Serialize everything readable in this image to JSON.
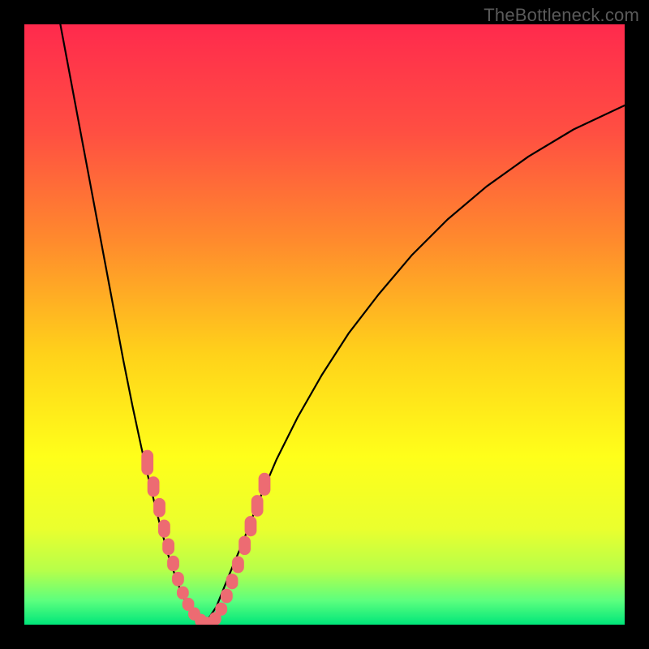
{
  "watermark": "TheBottleneck.com",
  "chart_data": {
    "type": "line",
    "title": "",
    "xlabel": "",
    "ylabel": "",
    "xlim": [
      0,
      100
    ],
    "ylim": [
      0,
      100
    ],
    "axes_visible": false,
    "grid": false,
    "background_gradient_stops": [
      {
        "offset": 0.0,
        "color": "#ff2a4d"
      },
      {
        "offset": 0.18,
        "color": "#ff4f42"
      },
      {
        "offset": 0.36,
        "color": "#ff8a2d"
      },
      {
        "offset": 0.55,
        "color": "#ffd21a"
      },
      {
        "offset": 0.72,
        "color": "#ffff1a"
      },
      {
        "offset": 0.84,
        "color": "#eaff2e"
      },
      {
        "offset": 0.91,
        "color": "#b6ff4a"
      },
      {
        "offset": 0.96,
        "color": "#5cff7e"
      },
      {
        "offset": 1.0,
        "color": "#00e67a"
      }
    ],
    "series": [
      {
        "name": "left-curve",
        "stroke": "#000000",
        "stroke_width": 2.2,
        "points": [
          {
            "x": 6.0,
            "y": 100.0
          },
          {
            "x": 7.5,
            "y": 92.0
          },
          {
            "x": 9.0,
            "y": 84.0
          },
          {
            "x": 10.5,
            "y": 76.0
          },
          {
            "x": 12.0,
            "y": 68.0
          },
          {
            "x": 13.5,
            "y": 60.0
          },
          {
            "x": 15.0,
            "y": 52.0
          },
          {
            "x": 16.5,
            "y": 44.0
          },
          {
            "x": 18.0,
            "y": 36.5
          },
          {
            "x": 19.5,
            "y": 29.5
          },
          {
            "x": 21.0,
            "y": 23.0
          },
          {
            "x": 22.5,
            "y": 17.0
          },
          {
            "x": 24.0,
            "y": 11.5
          },
          {
            "x": 25.5,
            "y": 7.0
          },
          {
            "x": 27.0,
            "y": 3.5
          },
          {
            "x": 28.5,
            "y": 1.2
          },
          {
            "x": 30.0,
            "y": 0.0
          }
        ]
      },
      {
        "name": "right-curve",
        "stroke": "#000000",
        "stroke_width": 2.2,
        "points": [
          {
            "x": 30.0,
            "y": 0.0
          },
          {
            "x": 32.0,
            "y": 3.0
          },
          {
            "x": 34.0,
            "y": 8.0
          },
          {
            "x": 36.5,
            "y": 14.0
          },
          {
            "x": 39.0,
            "y": 20.5
          },
          {
            "x": 42.0,
            "y": 27.5
          },
          {
            "x": 45.5,
            "y": 34.5
          },
          {
            "x": 49.5,
            "y": 41.5
          },
          {
            "x": 54.0,
            "y": 48.5
          },
          {
            "x": 59.0,
            "y": 55.0
          },
          {
            "x": 64.5,
            "y": 61.5
          },
          {
            "x": 70.5,
            "y": 67.5
          },
          {
            "x": 77.0,
            "y": 73.0
          },
          {
            "x": 84.0,
            "y": 78.0
          },
          {
            "x": 91.5,
            "y": 82.5
          },
          {
            "x": 100.0,
            "y": 86.5
          }
        ]
      }
    ],
    "markers": {
      "name": "salmon-dots-near-minimum",
      "shape": "rounded-rect",
      "fill": "#ed6b72",
      "points": [
        {
          "x": 20.5,
          "y": 27.0,
          "w": 2.0,
          "h": 4.2
        },
        {
          "x": 21.5,
          "y": 23.0,
          "w": 2.0,
          "h": 3.4
        },
        {
          "x": 22.5,
          "y": 19.5,
          "w": 2.0,
          "h": 3.2
        },
        {
          "x": 23.3,
          "y": 16.0,
          "w": 2.0,
          "h": 3.0
        },
        {
          "x": 24.0,
          "y": 13.0,
          "w": 2.0,
          "h": 2.8
        },
        {
          "x": 24.8,
          "y": 10.2,
          "w": 2.0,
          "h": 2.6
        },
        {
          "x": 25.6,
          "y": 7.6,
          "w": 2.0,
          "h": 2.4
        },
        {
          "x": 26.4,
          "y": 5.3,
          "w": 2.0,
          "h": 2.2
        },
        {
          "x": 27.3,
          "y": 3.4,
          "w": 2.0,
          "h": 2.2
        },
        {
          "x": 28.3,
          "y": 1.8,
          "w": 2.0,
          "h": 2.2
        },
        {
          "x": 29.4,
          "y": 0.7,
          "w": 2.0,
          "h": 2.2
        },
        {
          "x": 30.5,
          "y": 0.2,
          "w": 2.4,
          "h": 2.2
        },
        {
          "x": 31.8,
          "y": 1.0,
          "w": 2.0,
          "h": 2.2
        },
        {
          "x": 32.8,
          "y": 2.6,
          "w": 2.0,
          "h": 2.2
        },
        {
          "x": 33.7,
          "y": 4.8,
          "w": 2.0,
          "h": 2.4
        },
        {
          "x": 34.6,
          "y": 7.2,
          "w": 2.0,
          "h": 2.6
        },
        {
          "x": 35.6,
          "y": 10.0,
          "w": 2.0,
          "h": 2.8
        },
        {
          "x": 36.7,
          "y": 13.2,
          "w": 2.0,
          "h": 3.2
        },
        {
          "x": 37.7,
          "y": 16.4,
          "w": 2.0,
          "h": 3.4
        },
        {
          "x": 38.8,
          "y": 19.8,
          "w": 2.0,
          "h": 3.6
        },
        {
          "x": 40.0,
          "y": 23.4,
          "w": 2.0,
          "h": 3.8
        }
      ]
    }
  }
}
